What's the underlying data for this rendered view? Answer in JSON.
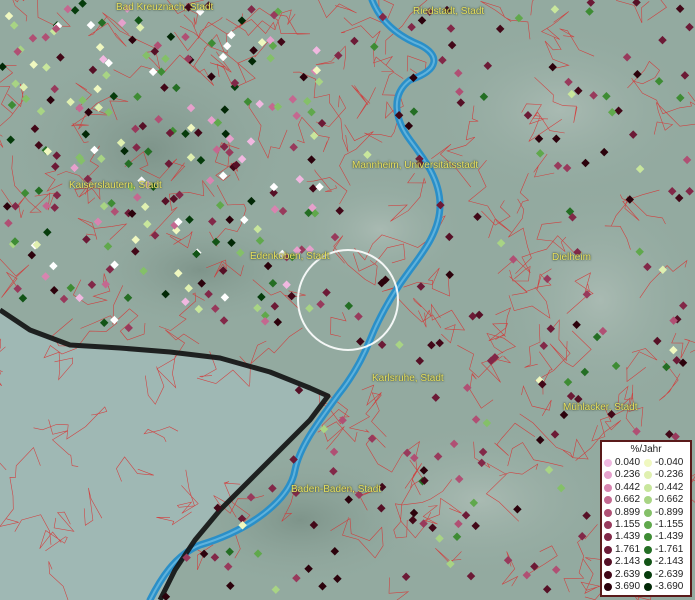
{
  "map": {
    "cities": [
      {
        "name": "Bad Kreuznach, Stadt"
      },
      {
        "name": "Riedstadt, Stadt"
      },
      {
        "name": "Mannheim, Universitätsstadt"
      },
      {
        "name": "Kaiserslautern, Stadt"
      },
      {
        "name": "Edenkoben, Stadt"
      },
      {
        "name": "Dielheim"
      },
      {
        "name": "Karlsruhe, Stadt"
      },
      {
        "name": "Mühlacker, Stadt"
      },
      {
        "name": "Baden-Baden, Stadt"
      }
    ],
    "colors": {
      "river": "#2a8fc8",
      "border": "#111111",
      "district_lines": "#d83030",
      "terrain": "#93aaa0"
    }
  },
  "legend": {
    "title": "%/Jahr",
    "positive": [
      {
        "label": "0.040",
        "color": "#f0b8e0"
      },
      {
        "label": "0.236",
        "color": "#e6a0cc"
      },
      {
        "label": "0.442",
        "color": "#d884b0"
      },
      {
        "label": "0.662",
        "color": "#c46890"
      },
      {
        "label": "0.899",
        "color": "#b05074"
      },
      {
        "label": "1.155",
        "color": "#983a5c"
      },
      {
        "label": "1.439",
        "color": "#822848"
      },
      {
        "label": "1.761",
        "color": "#6c1a36"
      },
      {
        "label": "2.143",
        "color": "#561026"
      },
      {
        "label": "2.639",
        "color": "#420818"
      },
      {
        "label": "3.690",
        "color": "#2c020c"
      }
    ],
    "negative": [
      {
        "label": "-0.040",
        "color": "#f0f8c0"
      },
      {
        "label": "-0.236",
        "color": "#e0f0b0"
      },
      {
        "label": "-0.442",
        "color": "#c8e69c"
      },
      {
        "label": "-0.662",
        "color": "#a8d484"
      },
      {
        "label": "-0.899",
        "color": "#84c068"
      },
      {
        "label": "-1.155",
        "color": "#60a84c"
      },
      {
        "label": "-1.439",
        "color": "#3e8c34"
      },
      {
        "label": "-1.761",
        "color": "#246e24"
      },
      {
        "label": "-2.143",
        "color": "#125416"
      },
      {
        "label": "-2.639",
        "color": "#063c0c"
      },
      {
        "label": "-3.690",
        "color": "#022806"
      }
    ]
  }
}
